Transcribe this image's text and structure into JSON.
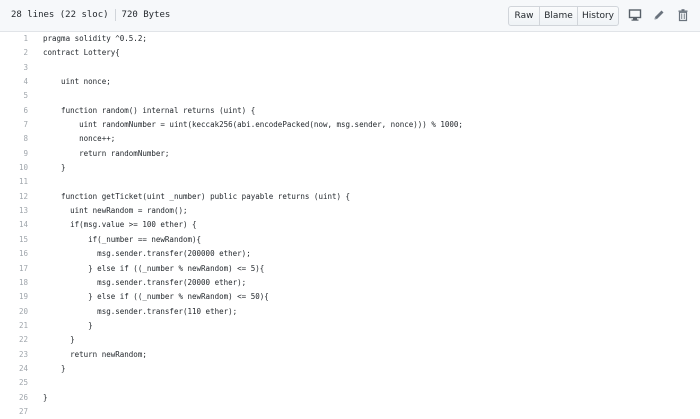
{
  "file_header": {
    "lines_info": "28 lines (22 sloc)",
    "size_info": "720 Bytes",
    "buttons": {
      "raw": "Raw",
      "blame": "Blame",
      "history": "History"
    },
    "icons": [
      "desktop-icon",
      "pencil-icon",
      "trash-icon"
    ]
  },
  "code_lines": [
    {
      "num": "1",
      "text": "pragma solidity ^0.5.2;"
    },
    {
      "num": "2",
      "text": "contract Lottery{"
    },
    {
      "num": "3",
      "text": ""
    },
    {
      "num": "4",
      "text": "    uint nonce;"
    },
    {
      "num": "5",
      "text": ""
    },
    {
      "num": "6",
      "text": "    function random() internal returns (uint) {"
    },
    {
      "num": "7",
      "text": "        uint randomNumber = uint(keccak256(abi.encodePacked(now, msg.sender, nonce))) % 1000;"
    },
    {
      "num": "8",
      "text": "        nonce++;"
    },
    {
      "num": "9",
      "text": "        return randomNumber;"
    },
    {
      "num": "10",
      "text": "    }"
    },
    {
      "num": "11",
      "text": ""
    },
    {
      "num": "12",
      "text": "    function getTicket(uint _number) public payable returns (uint) {"
    },
    {
      "num": "13",
      "text": "      uint newRandom = random();"
    },
    {
      "num": "14",
      "text": "      if(msg.value >= 100 ether) {"
    },
    {
      "num": "15",
      "text": "          if(_number == newRandom){"
    },
    {
      "num": "16",
      "text": "            msg.sender.transfer(200000 ether);"
    },
    {
      "num": "17",
      "text": "          } else if ((_number % newRandom) <= 5){"
    },
    {
      "num": "18",
      "text": "            msg.sender.transfer(20000 ether);"
    },
    {
      "num": "19",
      "text": "          } else if ((_number % newRandom) <= 50){"
    },
    {
      "num": "20",
      "text": "            msg.sender.transfer(110 ether);"
    },
    {
      "num": "21",
      "text": "          }"
    },
    {
      "num": "22",
      "text": "      }"
    },
    {
      "num": "23",
      "text": "      return newRandom;"
    },
    {
      "num": "24",
      "text": "    }"
    },
    {
      "num": "25",
      "text": ""
    },
    {
      "num": "26",
      "text": "}"
    },
    {
      "num": "27",
      "text": ""
    }
  ]
}
